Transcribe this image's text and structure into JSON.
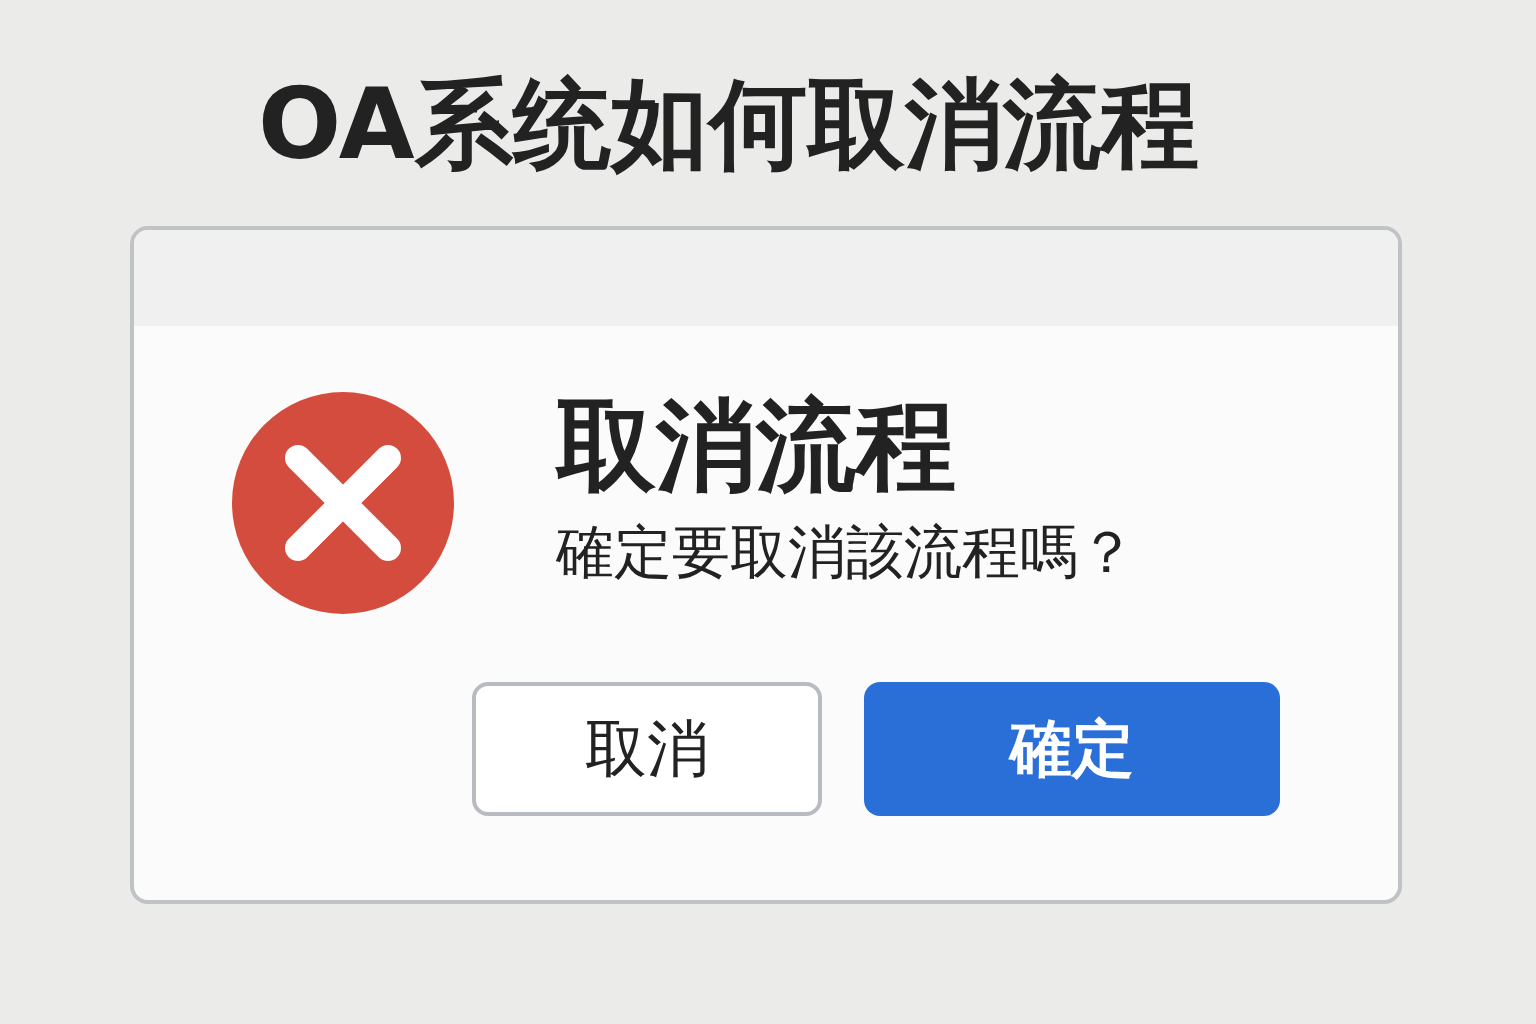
{
  "title": "OA系统如何取消流程",
  "dialog": {
    "heading": "取消流程",
    "message": "確定要取消該流程嗎？",
    "buttons": [
      {
        "label": "取消",
        "kind": "secondary"
      },
      {
        "label": "確定",
        "kind": "primary"
      }
    ]
  }
}
